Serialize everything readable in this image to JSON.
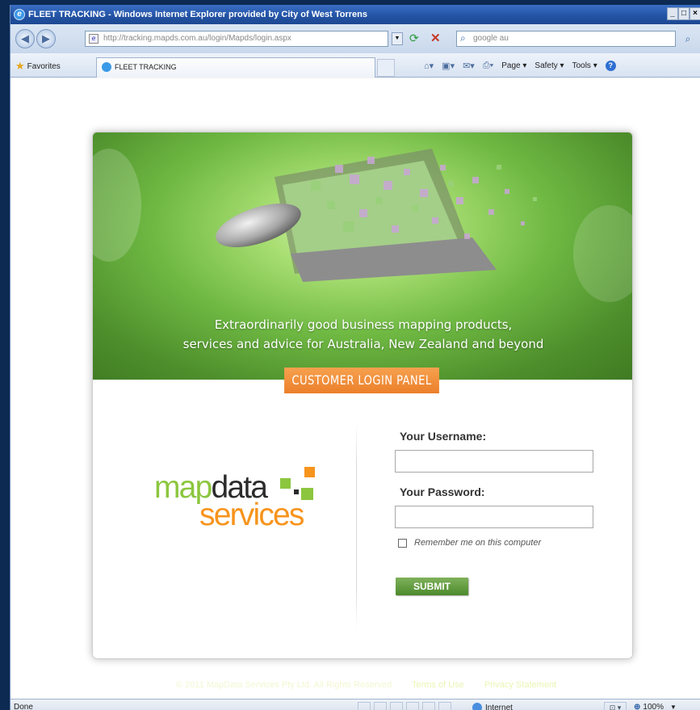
{
  "window": {
    "title": "FLEET TRACKING - Windows Internet Explorer provided by City of West Torrens",
    "min_label": "_",
    "max_label": "□",
    "close_label": "×"
  },
  "addressbar": {
    "url": "http://tracking.mapds.com.au/login/Mapds/login.aspx",
    "search_placeholder": "google au"
  },
  "favbar": {
    "favorites_label": "Favorites",
    "tab_label": "FLEET TRACKING",
    "commands": {
      "page": "Page ▾",
      "safety": "Safety ▾",
      "tools": "Tools ▾"
    }
  },
  "banner": {
    "tagline_line1": "Extraordinarily good business mapping products,",
    "tagline_line2": "services and advice for Australia, New Zealand and beyond",
    "panel_label": "CUSTOMER LOGIN PANEL"
  },
  "logo": {
    "text_map": "map",
    "text_data": "data",
    "text_services": "services",
    "colors": {
      "green": "#8cc63f",
      "orange": "#f7941d",
      "dark": "#2b2b2b"
    }
  },
  "form": {
    "username_label": "Your Username:",
    "username_value": "",
    "password_label": "Your Password:",
    "password_value": "",
    "remember_label": "Remember me on this computer",
    "remember_checked": false,
    "submit_label": "SUBMIT"
  },
  "footer": {
    "copyright": "© 2011 MapData Services Pty Ltd. All Rights Reserved",
    "terms_label": "Terms of Use",
    "privacy_label": "Privacy Statement"
  },
  "statusbar": {
    "status": "Done",
    "zone": "Internet",
    "zoom": "100%"
  },
  "colors": {
    "accent_green": "#4d8a2c",
    "accent_orange": "#ec7f2a",
    "titlebar_blue": "#2454a6"
  }
}
